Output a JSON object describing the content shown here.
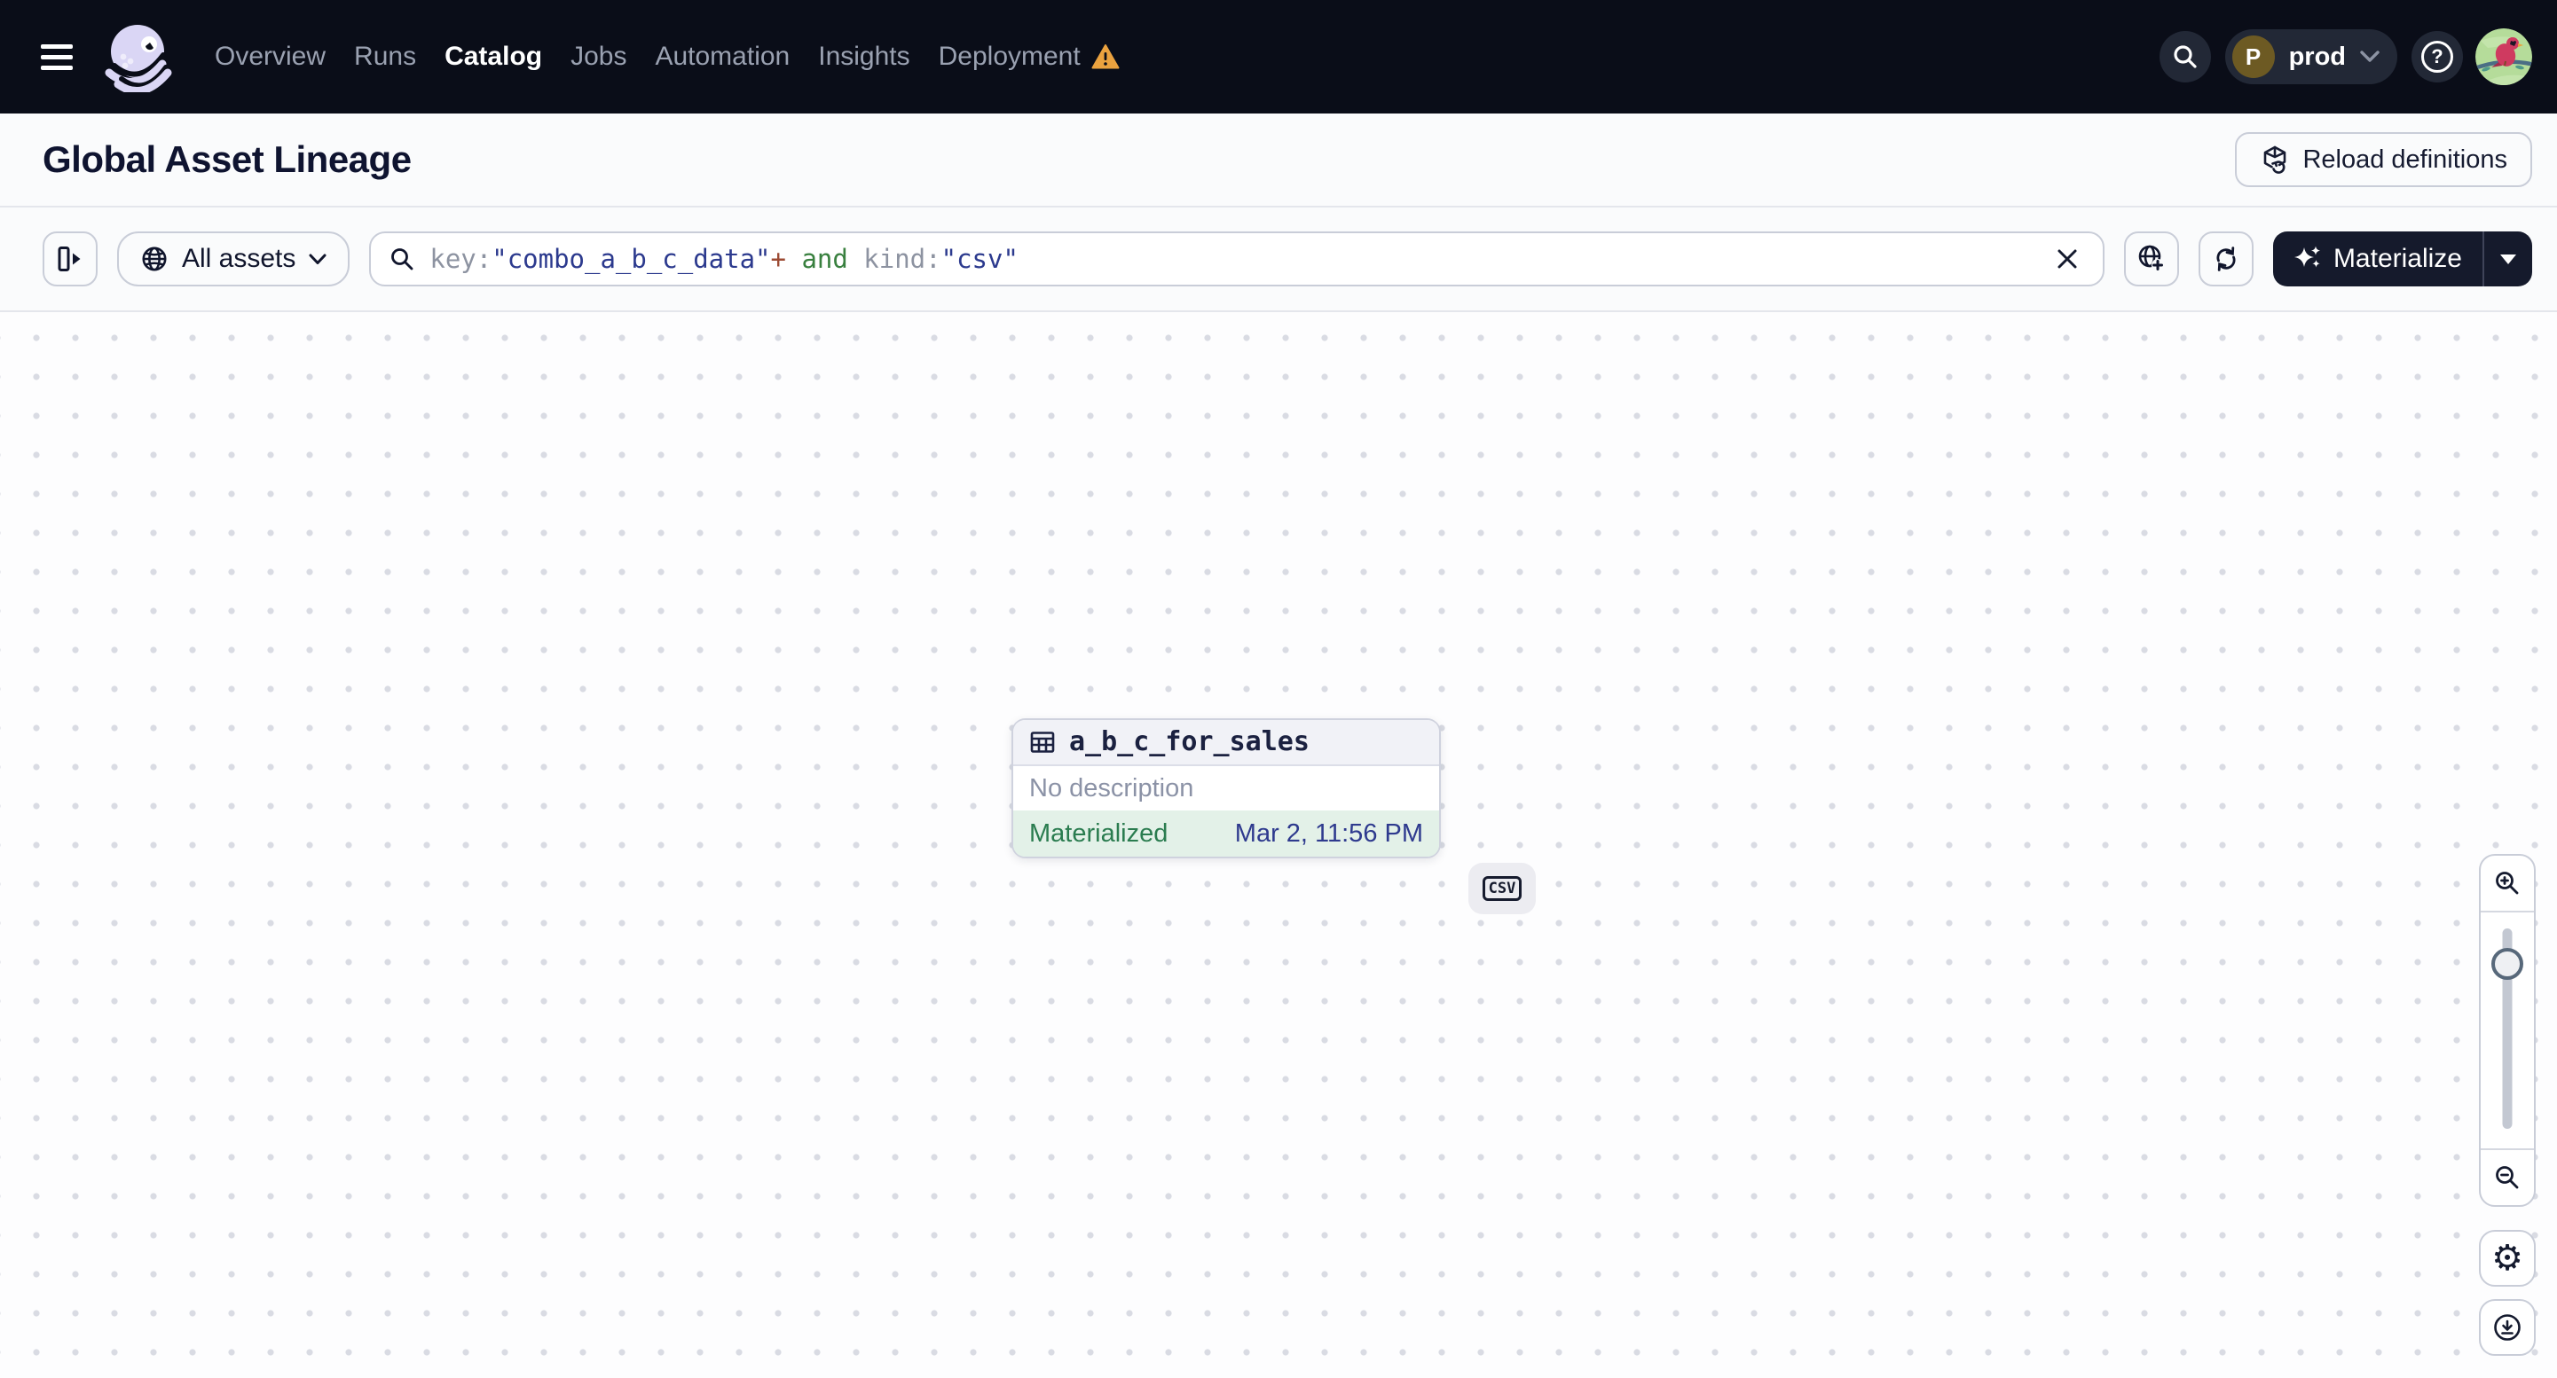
{
  "navbar": {
    "items": [
      {
        "label": "Overview"
      },
      {
        "label": "Runs"
      },
      {
        "label": "Catalog"
      },
      {
        "label": "Jobs"
      },
      {
        "label": "Automation"
      },
      {
        "label": "Insights"
      },
      {
        "label": "Deployment"
      }
    ],
    "active_item": "Catalog",
    "environment": {
      "initial": "P",
      "name": "prod"
    },
    "help_glyph": "?"
  },
  "page_header": {
    "title": "Global Asset Lineage",
    "reload_button": "Reload definitions"
  },
  "toolbar": {
    "scope_button": "All assets",
    "search": {
      "segments": [
        {
          "text": "key:"
        },
        {
          "text": "\"combo_a_b_c_data\""
        },
        {
          "text": "+"
        },
        {
          "text": " and "
        },
        {
          "text": "kind:"
        },
        {
          "text": "\"csv\""
        }
      ]
    },
    "materialize_button": "Materialize"
  },
  "graph": {
    "asset_node": {
      "name": "a_b_c_for_sales",
      "description": "No description",
      "status": "Materialized",
      "last_materialized": "Mar 2, 11:56 PM",
      "kind": "CSV"
    }
  },
  "icons": {
    "gear_glyph": "⚙"
  },
  "colors": {
    "navbar_bg": "#0a0d18",
    "warning_orange": "#eba23f",
    "status_green": "#2a7c4f",
    "timestamp_indigo": "#2e3a8e",
    "query_value": "#2c3a8e",
    "query_operator": "#9c4a33",
    "query_boolean": "#39803f",
    "materialize_bg": "#151a2c"
  }
}
